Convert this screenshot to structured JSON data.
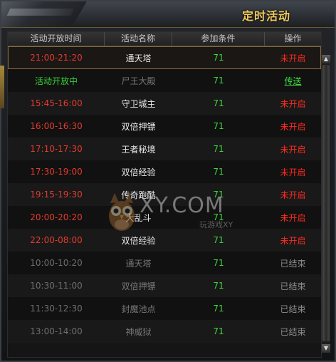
{
  "window": {
    "title": "定时活动"
  },
  "table": {
    "headers": [
      "活动开放时间",
      "活动名称",
      "参加条件",
      "操作"
    ],
    "rows": [
      {
        "time": "21:00-21:20",
        "name": "通天塔",
        "level": "71",
        "status": "未开启",
        "time_color": "red",
        "name_color": "white",
        "status_type": "closed",
        "selected": true
      },
      {
        "time": "活动开放中",
        "name": "尸王大殿",
        "level": "71",
        "status": "传送",
        "time_color": "green",
        "name_color": "grey",
        "status_type": "link",
        "selected": false
      },
      {
        "time": "15:45-16:00",
        "name": "守卫城主",
        "level": "71",
        "status": "未开启",
        "time_color": "red",
        "name_color": "white",
        "status_type": "closed",
        "selected": false
      },
      {
        "time": "16:00-16:30",
        "name": "双倍押镖",
        "level": "71",
        "status": "未开启",
        "time_color": "red",
        "name_color": "white",
        "status_type": "closed",
        "selected": false
      },
      {
        "time": "17:10-17:30",
        "name": "王者秘境",
        "level": "71",
        "status": "未开启",
        "time_color": "red",
        "name_color": "white",
        "status_type": "closed",
        "selected": false
      },
      {
        "time": "17:30-19:00",
        "name": "双倍经验",
        "level": "71",
        "status": "未开启",
        "time_color": "red",
        "name_color": "white",
        "status_type": "closed",
        "selected": false
      },
      {
        "time": "19:15-19:30",
        "name": "传奇跑酷",
        "level": "71",
        "status": "未开启",
        "time_color": "red",
        "name_color": "white",
        "status_type": "closed",
        "selected": false
      },
      {
        "time": "20:00-20:20",
        "name": "大乱斗",
        "level": "71",
        "status": "未开启",
        "time_color": "red",
        "name_color": "white",
        "status_type": "closed",
        "selected": false
      },
      {
        "time": "22:00-08:00",
        "name": "双倍经验",
        "level": "71",
        "status": "未开启",
        "time_color": "red",
        "name_color": "white",
        "status_type": "closed",
        "selected": false
      },
      {
        "time": "10:00-10:20",
        "name": "通天塔",
        "level": "71",
        "status": "已结束",
        "time_color": "grey",
        "name_color": "grey",
        "status_type": "done",
        "selected": false
      },
      {
        "time": "10:30-11:00",
        "name": "双倍押镖",
        "level": "71",
        "status": "已结束",
        "time_color": "grey",
        "name_color": "grey",
        "status_type": "done",
        "selected": false
      },
      {
        "time": "11:30-12:30",
        "name": "封魔池点",
        "level": "71",
        "status": "已结束",
        "time_color": "grey",
        "name_color": "grey",
        "status_type": "done",
        "selected": false
      },
      {
        "time": "13:00-14:00",
        "name": "神威狱",
        "level": "71",
        "status": "已结束",
        "time_color": "grey",
        "name_color": "grey",
        "status_type": "done",
        "selected": false
      }
    ]
  },
  "watermark": {
    "main": "XY.COM",
    "sub": "玩游戏XY"
  },
  "icons": {
    "scroll_up": "up-arrow-icon",
    "scroll_down": "down-arrow-icon"
  }
}
